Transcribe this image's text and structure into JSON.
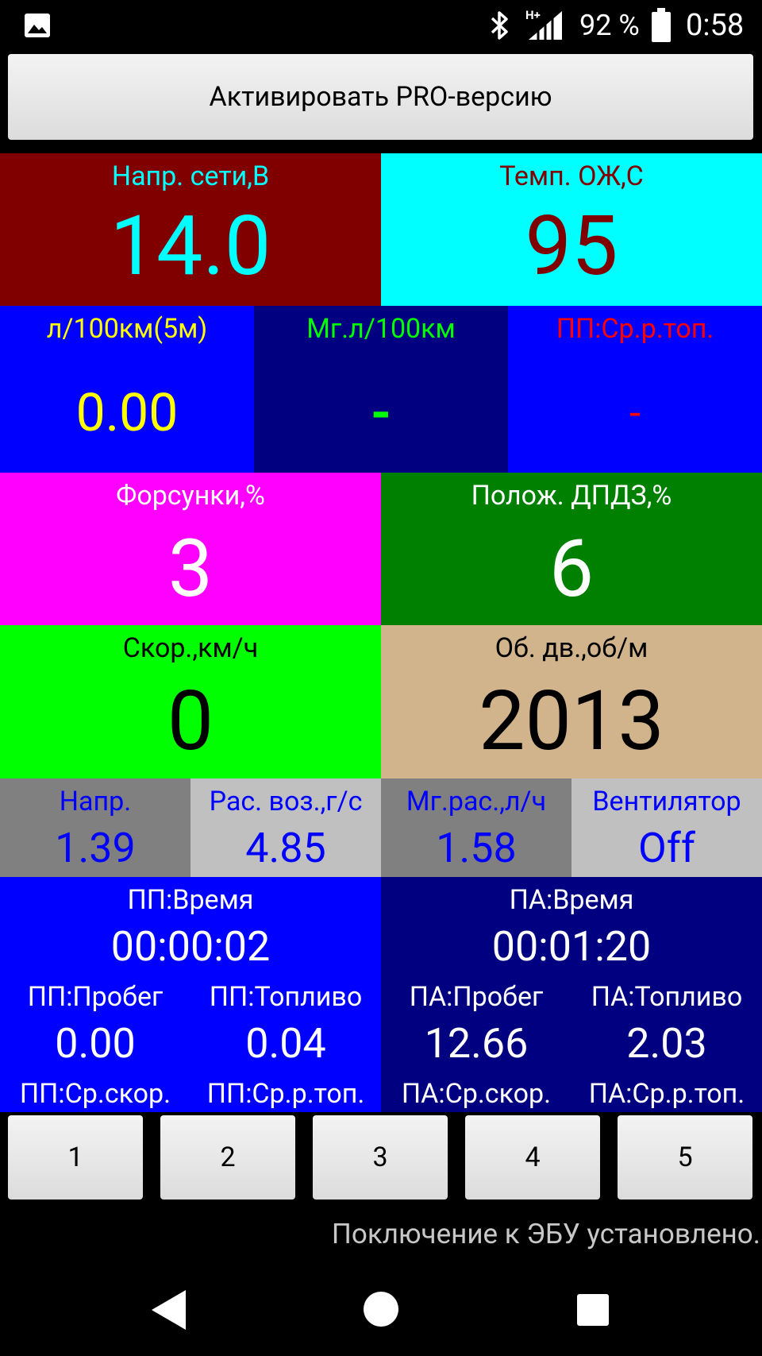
{
  "status_bar": {
    "battery": "92 %",
    "time": "0:58",
    "network": "H+"
  },
  "pro_button": "Активировать PRO-версию",
  "tiles": {
    "voltage": {
      "label": "Напр. сети,В",
      "value": "14.0"
    },
    "coolant": {
      "label": "Темп. ОЖ,С",
      "value": "95"
    },
    "fuel5m": {
      "label": "л/100км(5м)",
      "value": "0.00"
    },
    "inst_fuel": {
      "label": "Мг.л/100км",
      "value": "-"
    },
    "trip_avg_fuel_top": {
      "label": "ПП:Ср.р.топ.",
      "value": "-"
    },
    "injectors": {
      "label": "Форсунки,%",
      "value": "3"
    },
    "throttle": {
      "label": "Полож. ДПДЗ,%",
      "value": "6"
    },
    "speed": {
      "label": "Скор.,км/ч",
      "value": "0"
    },
    "rpm": {
      "label": "Об. дв.,об/м",
      "value": "2013"
    },
    "sensor_v": {
      "label": "Напр.",
      "value": "1.39"
    },
    "airflow": {
      "label": "Рас. воз.,г/с",
      "value": "4.85"
    },
    "inst_rate": {
      "label": "Мг.рас.,л/ч",
      "value": "1.58"
    },
    "fan": {
      "label": "Вентилятор",
      "value": "Off"
    }
  },
  "trip": {
    "time_label": "ПП:Время",
    "time": "00:00:02",
    "dist_label": "ПП:Пробег",
    "dist": "0.00",
    "fuel_label": "ПП:Топливо",
    "fuel": "0.04",
    "avg_speed_label": "ПП:Ср.скор.",
    "avg_fuel_label": "ПП:Ср.р.топ."
  },
  "total": {
    "time_label": "ПА:Время",
    "time": "00:01:20",
    "dist_label": "ПА:Пробег",
    "dist": "12.66",
    "fuel_label": "ПА:Топливо",
    "fuel": "2.03",
    "avg_speed_label": "ПА:Ср.скор.",
    "avg_fuel_label": "ПА:Ср.р.топ."
  },
  "page_buttons": [
    "1",
    "2",
    "3",
    "4",
    "5"
  ],
  "status_message": "Поключение к ЭБУ установлено.",
  "colors": {
    "voltage_bg": "#800000",
    "coolant_bg": "#00ffff",
    "blue": "#0000ff",
    "navy": "#000080",
    "magenta": "#ff00ff",
    "green": "#008000",
    "lime": "#00ff00",
    "tan": "#d2b48c",
    "gray": "#808080",
    "silver": "#c0c0c0"
  }
}
